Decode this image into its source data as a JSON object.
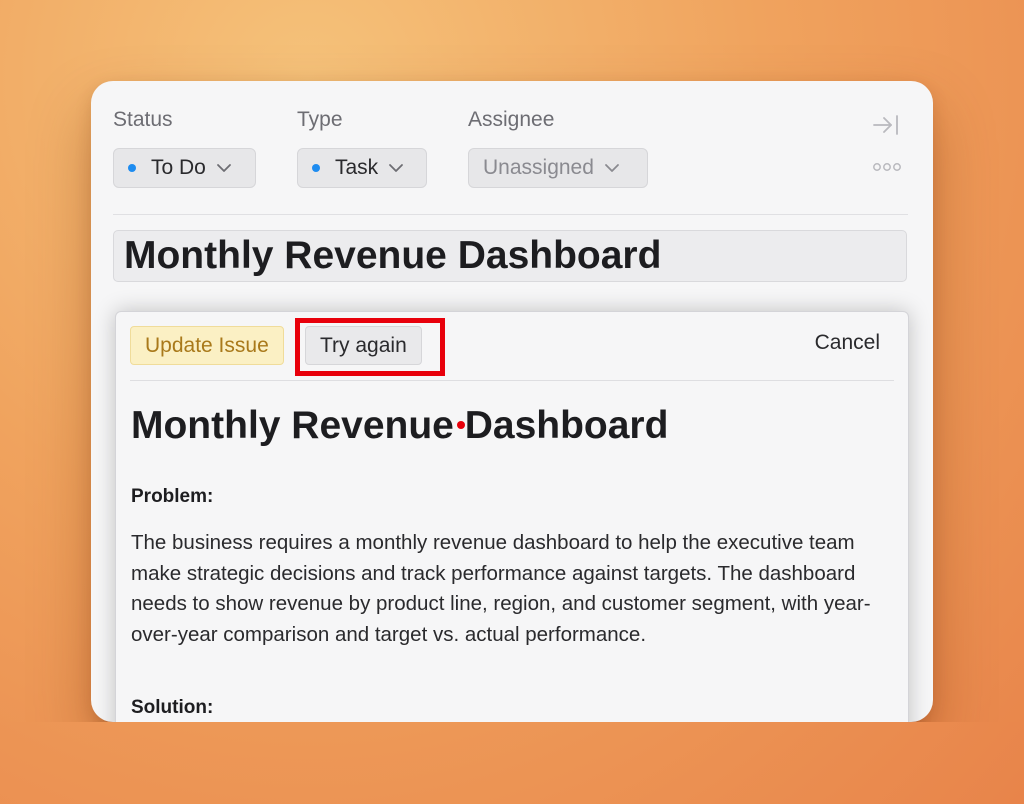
{
  "fields": {
    "status": {
      "label": "Status",
      "value": "To Do",
      "dot_color": "#1e8cf0"
    },
    "type": {
      "label": "Type",
      "value": "Task",
      "dot_color": "#1e8cf0"
    },
    "assignee": {
      "label": "Assignee",
      "value": "Unassigned"
    }
  },
  "header_icons": [
    "collapse-panel-icon",
    "more-options-icon"
  ],
  "issue_title": "Monthly Revenue Dashboard",
  "panel": {
    "update_label": "Update Issue",
    "try_again_label": "Try again",
    "cancel_label": "Cancel",
    "doc_title": "Monthly Revenue Dashboard",
    "problem_heading": "Problem:",
    "problem_text": "The business requires a monthly revenue dashboard to help the executive team make strategic decisions and track performance against targets. The dashboard needs to show revenue by product line, region, and customer segment, with year-over-year comparison and target vs. actual performance.",
    "solution_heading": "Solution:"
  },
  "colors": {
    "highlight": "#e8000b",
    "update_bg": "#fbf0c4",
    "update_text": "#a9791a"
  }
}
